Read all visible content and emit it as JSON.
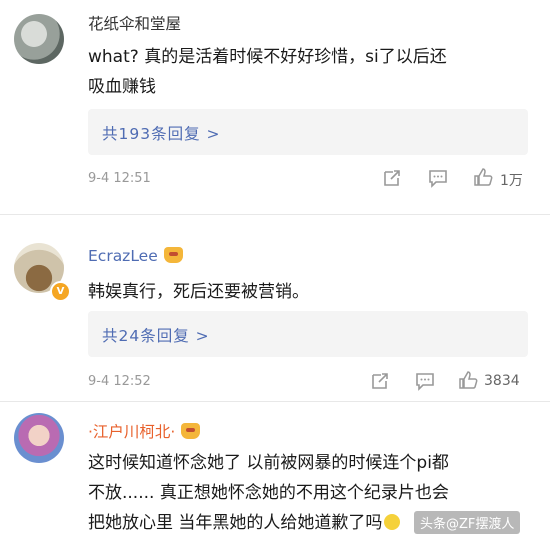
{
  "comments": [
    {
      "username": "花纸伞和堂屋",
      "text_line1": "what? 真的是活着时候不好好珍惜，si了以后还",
      "text_line2": "吸血赚钱",
      "replies": "共193条回复 >",
      "time": "9-4 12:51",
      "likes": "1万"
    },
    {
      "username": "EcrazLee",
      "text_line1": "韩娱真行，死后还要被营销。",
      "replies": "共24条回复 >",
      "time": "9-4 12:52",
      "likes": "3834"
    },
    {
      "username": "·江户川柯北·",
      "text_line1": "这时候知道怀念她了 以前被网暴的时候连个pi都",
      "text_line2": "不放...... 真正想她怀念她的不用这个纪录片也会",
      "text_line3": "把她放心里 当年黑她的人给她道歉了吗"
    }
  ],
  "watermark": "头条@ZF摆渡人",
  "icons": {
    "share": "share-icon",
    "comment": "comment-icon",
    "like": "thumbs-up-icon",
    "verified": "verified-badge-icon",
    "vip": "crown-icon"
  },
  "colors": {
    "link_blue": "#4f6cb3",
    "vip_orange": "#e8612c",
    "meta_gray": "#999999",
    "reply_bg": "#f4f4f4"
  }
}
